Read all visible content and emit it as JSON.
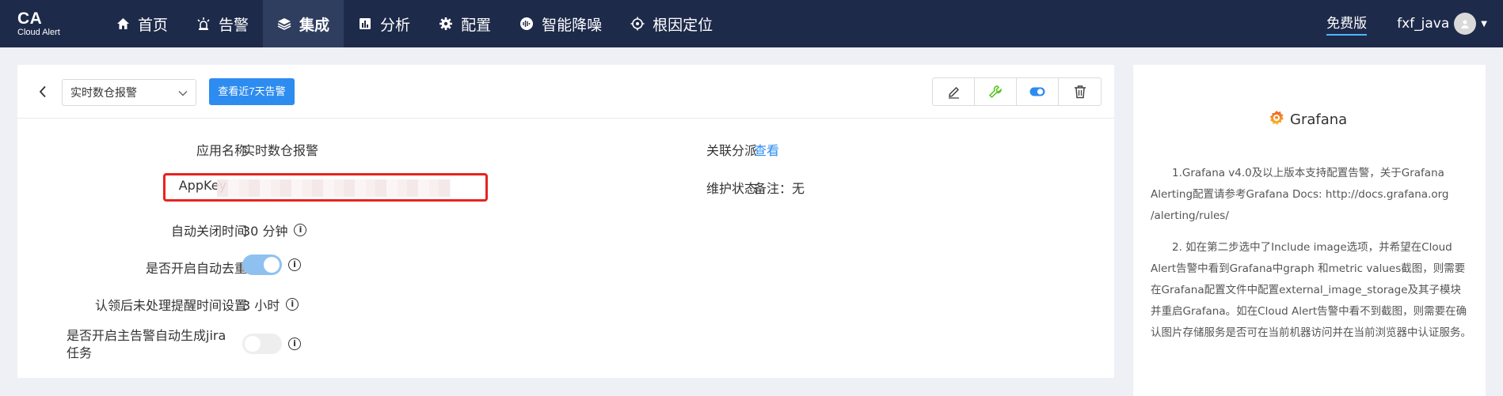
{
  "brand": {
    "name": "CA",
    "subtitle": "Cloud Alert"
  },
  "nav": {
    "items": [
      {
        "label": "首页",
        "icon": "home-icon"
      },
      {
        "label": "告警",
        "icon": "alarm-icon"
      },
      {
        "label": "集成",
        "icon": "layers-icon",
        "active": true
      },
      {
        "label": "分析",
        "icon": "chart-icon"
      },
      {
        "label": "配置",
        "icon": "gear-icon"
      },
      {
        "label": "智能降噪",
        "icon": "noise-icon"
      },
      {
        "label": "根因定位",
        "icon": "target-icon"
      }
    ],
    "plan": "免费版",
    "user": "fxf_java"
  },
  "toolbar": {
    "app_select": "实时数仓报警",
    "view_button": "查看近7天告警",
    "actions": [
      "edit-icon",
      "wrench-icon",
      "toggle-icon",
      "trash-icon"
    ]
  },
  "details": {
    "app_name_label": "应用名称",
    "app_name_value": "实时数仓报警",
    "appkey_label": "AppKey",
    "auto_close_label": "自动关闭时间",
    "auto_close_value": "30 分钟",
    "dedupe_label": "是否开启自动去重",
    "dedupe_on": true,
    "reminder_label": "认领后未处理提醒时间设置",
    "reminder_value": "3 小时",
    "jira_label_line1": "是否开启主告警自动生成jira",
    "jira_label_line2": "任务",
    "jira_on": false,
    "dispatch_label": "关联分派",
    "dispatch_value": "查看",
    "maintenance_label": "维护状态",
    "maintenance_value": "备注：无"
  },
  "side": {
    "title": "Grafana",
    "note1": "1.Grafana v4.0及以上版本支持配置告警，关于Grafana Alerting配置请参考Grafana Docs: http://docs.grafana.org /alerting/rules/",
    "note2": "2. 如在第二步选中了Include image选项，并希望在Cloud Alert告警中看到Grafana中graph 和metric values截图，则需要在Grafana配置文件中配置external_image_storage及其子模块并重启Grafana。如在Cloud Alert告警中看不到截图，则需要在确认图片存储服务是否可在当前机器访问并在当前浏览器中认证服务。"
  },
  "colors": {
    "nav_bg": "#1e2a4a",
    "primary": "#2d8cf0",
    "highlight": "#e8231f"
  }
}
